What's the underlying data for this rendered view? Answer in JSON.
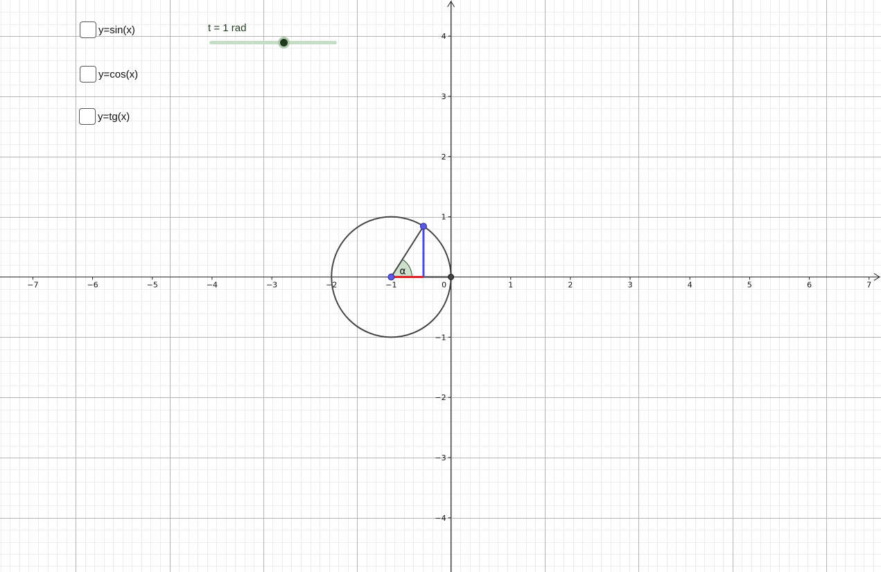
{
  "window": {
    "title": ""
  },
  "checkboxes": [
    {
      "label": "y=sin(x)",
      "checked": false
    },
    {
      "label": "y=cos(x)",
      "checked": false
    },
    {
      "label": "y=tg(x)",
      "checked": false
    }
  ],
  "slider": {
    "label": "t = 1 rad",
    "value": 1,
    "min": -6,
    "max": 6
  },
  "axes": {
    "x_range": [
      -7.55,
      7.2
    ],
    "y_range": [
      -4.9,
      4.6
    ],
    "x_ticks": [
      -7,
      -6,
      -5,
      -4,
      -3,
      -2,
      -1,
      0,
      1,
      2,
      3,
      4,
      5,
      6,
      7
    ],
    "y_ticks": [
      -4,
      -3,
      -2,
      -1,
      1,
      2,
      3,
      4
    ],
    "zero_label": "0",
    "minus_sign": "−",
    "major_grid_step": 1.5708,
    "minor_grid_step": 0.15708
  },
  "figure": {
    "circle_center": [
      -1,
      0
    ],
    "circle_radius": 1,
    "angle_rad": 1,
    "angle_label": "α"
  },
  "colors": {
    "grid_major": "#b4b4b4",
    "grid_minor": "#ececec",
    "axis": "#222222",
    "circle": "#444444",
    "radius": "#444444",
    "sine_segment": "#4a4ae0",
    "cosine_segment": "#e02020",
    "angle_fill": "#cfe0cf",
    "point_blue": "#5a5ae8",
    "point_dark": "#444444"
  }
}
